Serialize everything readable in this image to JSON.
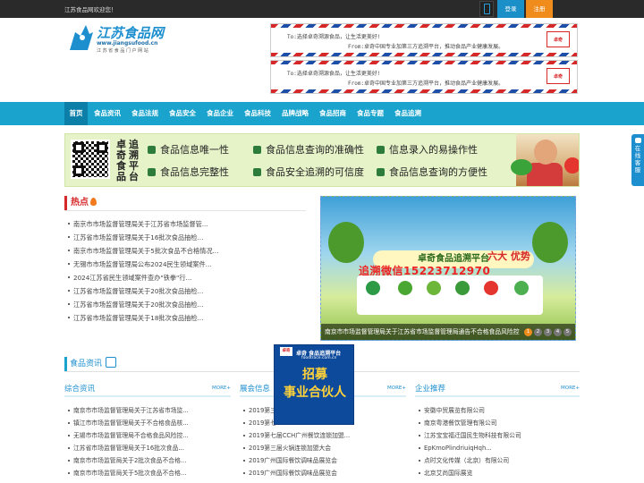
{
  "topbar": {
    "welcome": "江苏食品网欢迎您！",
    "login": "登录",
    "register": "注册"
  },
  "logo": {
    "name": "江苏食品网",
    "url": "www.jiangsufood.cn",
    "tagline": "江 苏 省 食 品 门 户 网 站"
  },
  "header_ads": [
    {
      "to": "To:选择卓奇溯源食品，让生活更美好!",
      "from": "From:卓奇中国专业加第三方追溯平台，推动食品产业健康发展。",
      "brand": "卓奇"
    },
    {
      "to": "To:选择卓奇溯源食品，让生活更美好!",
      "from": "From:卓奇中国专业加第三方追溯平台，推动食品产业健康发展。",
      "brand": "卓奇"
    }
  ],
  "nav": {
    "items": [
      "首页",
      "食品资讯",
      "食品法规",
      "食品安全",
      "食品企业",
      "食品科技",
      "品牌战略",
      "食品招商",
      "食品专题",
      "食品追溯"
    ],
    "active": "首页"
  },
  "banner": {
    "vertical1": "卓奇食品",
    "vertical2": "追溯平台",
    "features": [
      "食品信息唯一性",
      "食品信息查询的准确性",
      "信息录入的易操作性",
      "食品信息完整性",
      "食品安全追溯的可信度",
      "食品信息查询的方便性"
    ]
  },
  "hot": {
    "title": "热点",
    "items": [
      "南京市市场监督管理局关于江苏省市场监督管...",
      "江苏省市场监督管理局关于16批次食品抽检...",
      "南京市市场监督管理局关于5批次食品不合格情况...",
      "无锡市市场监督管理局公布2024民生领域案件...",
      "2024江苏省民生领域案件查办\"铁拳\"行...",
      "江苏省市场监督管理局关于20批次食品抽检...",
      "江苏省市场监督管理局关于20批次食品抽检...",
      "江苏省市场监督管理局关于18批次食品抽检..."
    ]
  },
  "slider": {
    "plate": "卓奇食品追溯平台",
    "six": "六大 优势",
    "phone": "追溯微信15223712970",
    "caption": "南京市市场监督管理局关于江苏省市场监督管理局通告不合格食品风险控",
    "dots": [
      "1",
      "2",
      "3",
      "4",
      "5"
    ],
    "active_dot": "1"
  },
  "section": {
    "title": "食品资讯",
    "more": "MORE+"
  },
  "columns": [
    {
      "title": "综合资讯",
      "items": [
        "南京市市场监督管理局关于江苏省市场监...",
        "镇江市市场监督管理局关于不合格食品核...",
        "无锡市市场监督管理局不合格食品风险控...",
        "江苏省市场监督管理局关于16批次食品...",
        "南京市市场监管局关于2批次食品不合格...",
        "南京市市场监管局关于5批次食品不合格..."
      ]
    },
    {
      "title": "展会信息",
      "items": [
        "2019第三...",
        "2019第七...",
        "2019第七届CCH广州餐饮连锁加盟...",
        "2019第三届火锅连锁加盟大会",
        "2019广州国际餐饮调味品展览会",
        "2019广州国际餐饮调味品展览会"
      ]
    },
    {
      "title": "企业推荐",
      "items": [
        "安徽中贸展览有限公司",
        "南京粤港餐饮管理有限公司",
        "江苏宝宝福迁国民生物科技有限公司",
        "EpKmoPlindriuiqHqh...",
        "点时文化传媒（北京）有限公司",
        "北京艾尚国际展览"
      ]
    }
  ],
  "popup": {
    "brand": "卓奇 食品追溯平台",
    "site": "foodtrace.com.cn",
    "line1": "招募",
    "line2": "事业合伙人",
    "badge": "卓奇"
  },
  "service": {
    "label": "在线客服"
  }
}
